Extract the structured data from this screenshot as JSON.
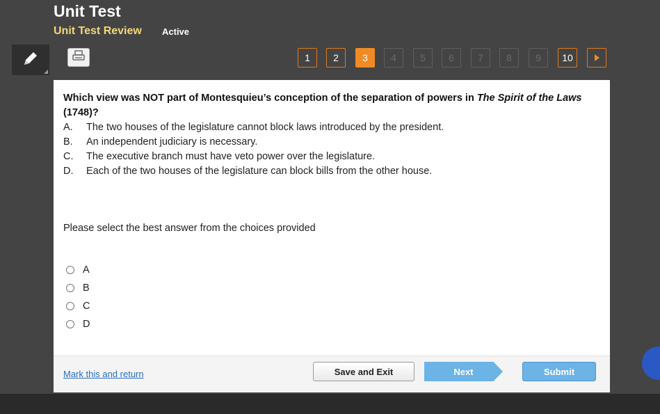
{
  "header": {
    "title": "Unit Test",
    "subtitle": "Unit Test Review",
    "status": "Active"
  },
  "toolbar": {
    "pencil_icon": "pencil-icon",
    "print_icon": "printer-icon"
  },
  "pager": {
    "pages": [
      {
        "label": "1",
        "state": "answered"
      },
      {
        "label": "2",
        "state": "answered"
      },
      {
        "label": "3",
        "state": "active"
      },
      {
        "label": "4",
        "state": "disabled"
      },
      {
        "label": "5",
        "state": "disabled"
      },
      {
        "label": "6",
        "state": "disabled"
      },
      {
        "label": "7",
        "state": "disabled"
      },
      {
        "label": "8",
        "state": "disabled"
      },
      {
        "label": "9",
        "state": "disabled"
      },
      {
        "label": "10",
        "state": "answered"
      }
    ],
    "next_icon": "play-right-icon",
    "colors": {
      "accent": "#f08a24",
      "disabled": "#6a6a6a"
    }
  },
  "question": {
    "prefix": "Which view was NOT part of Montesquieu’s conception of the separation of powers in ",
    "italic": "The Spirit of the Laws",
    "suffix": " (1748)?",
    "choices": [
      {
        "letter": "A.",
        "text": "The two houses of the legislature cannot block laws introduced by the president."
      },
      {
        "letter": "B.",
        "text": "An independent judiciary is necessary."
      },
      {
        "letter": "C.",
        "text": "The executive branch must have veto power over the legislature."
      },
      {
        "letter": "D.",
        "text": "Each of the two houses of the legislature can block bills from the other house."
      }
    ],
    "instruction": "Please select the best answer from the choices provided"
  },
  "answers": {
    "options": [
      "A",
      "B",
      "C",
      "D"
    ]
  },
  "footer": {
    "mark_label": "Mark this and return",
    "save_label": "Save and Exit",
    "next_label": "Next",
    "submit_label": "Submit"
  }
}
